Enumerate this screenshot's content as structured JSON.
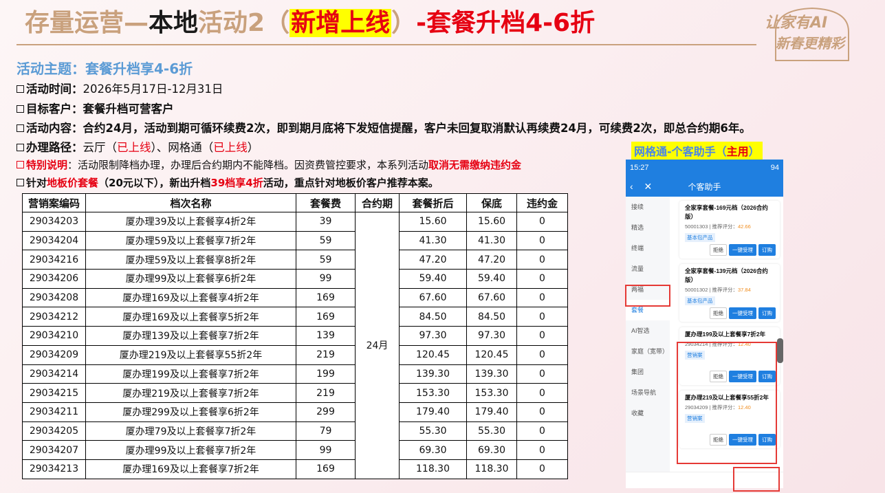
{
  "header": {
    "title_part1": "存量运营—",
    "title_part2": "本地",
    "title_part3": "活动2（",
    "title_highlight": "新增上线",
    "title_part4": "）",
    "title_part5": "-套餐升档4-6折",
    "logo_line1": "让家有AI",
    "logo_line2": "新春更精彩"
  },
  "info": {
    "theme": "活动主题：套餐升档享4-6折",
    "time_label": "活动时间：",
    "time_value": "2026年5月17日-12月31日",
    "target_label": "目标客户：",
    "target_value": "套餐升档可营客户",
    "content_label": "活动内容：",
    "content_value": "合约24月，活动到期可循环续费2次，即到期月底将下发短信提醒，客户未回复取消默认再续费24月，可续费2次，即总合约期6年。",
    "route_label": "办理路径：",
    "route_a": "云厅（",
    "route_a_status": "已上线",
    "route_b": "）、网格通（",
    "route_b_status": "已上线",
    "route_c": "）",
    "special_label": "特别说明",
    "special_text": "：活动限制降档办理，办理后合约期内不能降档。因资费管控要求，本系列活动",
    "special_red": "取消无需缴纳违约金",
    "target2_a": "针对",
    "target2_red": "地板价套餐",
    "target2_b": "（20元以下），新出升档",
    "target2_red2": "39档享4折",
    "target2_c": "活动，重点针对地板价客户推荐本案。"
  },
  "table": {
    "headers": [
      "营销案编码",
      "档次名称",
      "套餐费",
      "合约期",
      "套餐折后",
      "保底",
      "违约金"
    ],
    "term": "24月",
    "rows": [
      [
        "29034203",
        "厦办理39及以上套餐享4折2年",
        "39",
        "15.60",
        "15.60",
        "0"
      ],
      [
        "29034204",
        "厦办理59及以上套餐享7折2年",
        "59",
        "41.30",
        "41.30",
        "0"
      ],
      [
        "29034216",
        "厦办理59及以上套餐享8折2年",
        "59",
        "47.20",
        "47.20",
        "0"
      ],
      [
        "29034206",
        "厦办理99及以上套餐享6折2年",
        "99",
        "59.40",
        "59.40",
        "0"
      ],
      [
        "29034208",
        "厦办理169及以上套餐享4折2年",
        "169",
        "67.60",
        "67.60",
        "0"
      ],
      [
        "29034212",
        "厦办理169及以上套餐享5折2年",
        "169",
        "84.50",
        "84.50",
        "0"
      ],
      [
        "29034210",
        "厦办理139及以上套餐享7折2年",
        "139",
        "97.30",
        "97.30",
        "0"
      ],
      [
        "29034209",
        "厦办理219及以上套餐享55折2年",
        "219",
        "120.45",
        "120.45",
        "0"
      ],
      [
        "29034214",
        "厦办理199及以上套餐享7折2年",
        "199",
        "139.30",
        "139.30",
        "0"
      ],
      [
        "29034215",
        "厦办理219及以上套餐享7折2年",
        "219",
        "153.30",
        "153.30",
        "0"
      ],
      [
        "29034211",
        "厦办理299及以上套餐享6折2年",
        "299",
        "179.40",
        "179.40",
        "0"
      ],
      [
        "29034205",
        "厦办理79及以上套餐享7折2年",
        "79",
        "55.30",
        "55.30",
        "0"
      ],
      [
        "29034207",
        "厦办理99及以上套餐享7折2年",
        "99",
        "69.30",
        "69.30",
        "0"
      ],
      [
        "29034213",
        "厦办理169及以上套餐享7折2年",
        "169",
        "118.30",
        "118.30",
        "0"
      ]
    ]
  },
  "phone": {
    "caption": "网格通-个客助手（",
    "caption_red": "主用",
    "caption_end": "）",
    "status_time": "15:27",
    "status_right": "94",
    "app_title": "个客助手",
    "side_items": [
      "接续",
      "精选",
      "终端",
      "流量",
      "两福",
      "套餐",
      "AI智选",
      "家庭（宽带）",
      "集团",
      "场景导航",
      "收藏"
    ],
    "cards": [
      {
        "title": "全家享套餐-169元档（2026合约版）",
        "code": "50001303",
        "score_label": "推荐评分：",
        "score": "42.66",
        "tag": "基本包产品"
      },
      {
        "title": "全家享套餐-139元档（2026合约版）",
        "code": "50001302",
        "score_label": "推荐评分：",
        "score": "37.84",
        "tag": "基本包产品"
      },
      {
        "title": "厦办理199及以上套餐享7折2年",
        "code": "29034214",
        "score_label": "推荐评分：",
        "score": "12.40",
        "tag": "营销案"
      },
      {
        "title": "厦办理219及以上套餐享55折2年",
        "code": "29034209",
        "score_label": "推荐评分：",
        "score": "12.40",
        "tag": "营销案"
      }
    ],
    "btn_reject": "拒绝",
    "btn_accept": "一键受理",
    "btn_order": "订购",
    "accent": "#1f7fe0",
    "highlight": "#e53935"
  }
}
